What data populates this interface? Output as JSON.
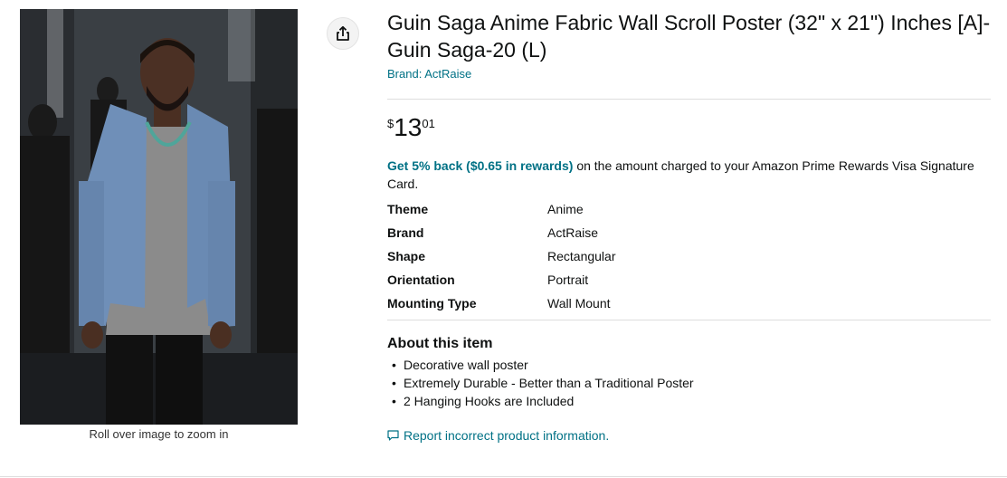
{
  "image": {
    "zoom_hint": "Roll over image to zoom in"
  },
  "share": {
    "icon": "share-icon"
  },
  "product": {
    "title": "Guin Saga Anime Fabric Wall Scroll Poster (32\" x 21\") Inches [A]-Guin Saga-20 (L)",
    "brand_link": "Brand: ActRaise",
    "price": {
      "symbol": "$",
      "whole": "13",
      "fraction": "01"
    },
    "rewards": {
      "highlight": "Get 5% back ($0.65 in rewards)",
      "rest": " on the amount charged to your Amazon Prime Rewards Visa Signature Card."
    },
    "specs": [
      {
        "key": "Theme",
        "value": "Anime"
      },
      {
        "key": "Brand",
        "value": "ActRaise"
      },
      {
        "key": "Shape",
        "value": "Rectangular"
      },
      {
        "key": "Orientation",
        "value": "Portrait"
      },
      {
        "key": "Mounting Type",
        "value": "Wall Mount"
      }
    ],
    "about": {
      "heading": "About this item",
      "bullets": [
        "Decorative wall poster",
        "Extremely Durable - Better than a Traditional Poster",
        "2 Hanging Hooks are Included"
      ]
    },
    "report_link": "Report incorrect product information."
  },
  "colors": {
    "link": "#007185",
    "text": "#0f1111",
    "divider": "#dddddd"
  }
}
